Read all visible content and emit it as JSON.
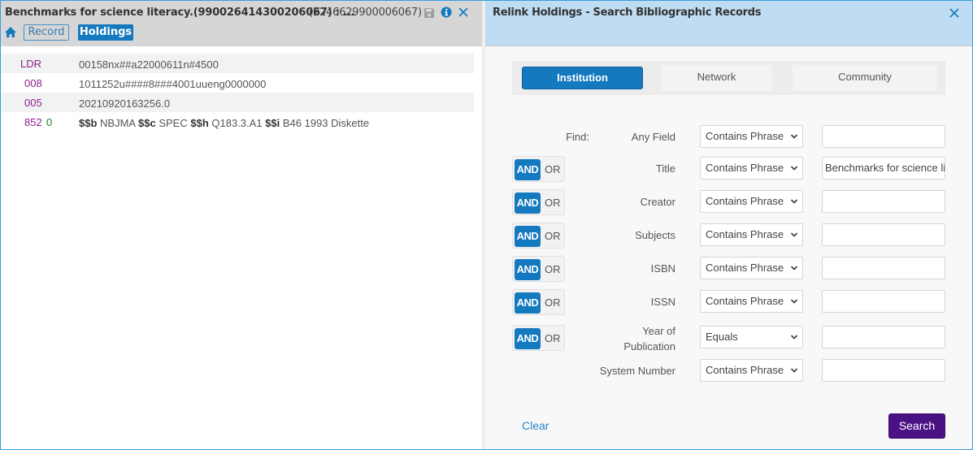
{
  "left_pane": {
    "title": "Benchmarks for science literacy.(990026414300206067) : ...",
    "record_id": "(2246629900006067)",
    "icons": {
      "save": "save-icon",
      "info": "info-icon",
      "close": "close-icon",
      "home": "home-icon"
    },
    "nav": {
      "record_label": "Record",
      "holdings_label": "Holdings"
    },
    "marc_fields": [
      {
        "tag": "LDR",
        "indicators": "",
        "value": "00158nx##a22000611n#4500"
      },
      {
        "tag": "008",
        "indicators": "",
        "value": "1011252u####8###4001uueng0000000"
      },
      {
        "tag": "005",
        "indicators": "",
        "value": "20210920163256.0"
      },
      {
        "tag": "852",
        "indicators": "0",
        "subfields": [
          {
            "code": "$$b",
            "value": "NBJMA"
          },
          {
            "code": "$$c",
            "value": "SPEC"
          },
          {
            "code": "$$h",
            "value": "Q183.3.A1"
          },
          {
            "code": "$$i",
            "value": "B46 1993 Diskette"
          }
        ]
      }
    ]
  },
  "right_pane": {
    "title": "Relink Holdings - Search Bibliographic Records",
    "close_icon": "close-icon",
    "tabs": [
      {
        "label": "Institution",
        "active": true
      },
      {
        "label": "Network",
        "active": false
      },
      {
        "label": "Community",
        "active": false
      }
    ],
    "find_label": "Find:",
    "rows": [
      {
        "field": "Any Field",
        "operator": "Contains Phrase",
        "value": "",
        "boolean": null
      },
      {
        "field": "Title",
        "operator": "Contains Phrase",
        "value": "Benchmarks for science literacy",
        "boolean": {
          "and": "AND",
          "or": "OR",
          "selected": "AND"
        }
      },
      {
        "field": "Creator",
        "operator": "Contains Phrase",
        "value": "",
        "boolean": {
          "and": "AND",
          "or": "OR",
          "selected": "AND"
        }
      },
      {
        "field": "Subjects",
        "operator": "Contains Phrase",
        "value": "",
        "boolean": {
          "and": "AND",
          "or": "OR",
          "selected": "AND"
        }
      },
      {
        "field": "ISBN",
        "operator": "Contains Phrase",
        "value": "",
        "boolean": {
          "and": "AND",
          "or": "OR",
          "selected": "AND"
        }
      },
      {
        "field": "ISSN",
        "operator": "Contains Phrase",
        "value": "",
        "boolean": {
          "and": "AND",
          "or": "OR",
          "selected": "AND"
        }
      },
      {
        "field": "Year of Publication",
        "operator": "Equals",
        "value": "",
        "boolean": {
          "and": "AND",
          "or": "OR",
          "selected": "AND"
        }
      },
      {
        "field": "System Number",
        "operator": "Contains Phrase",
        "value": "",
        "boolean": null
      }
    ],
    "clear_label": "Clear",
    "search_label": "Search"
  },
  "colors": {
    "primary": "#1479bf",
    "search_button": "#4b1284",
    "link": "#2b87c8",
    "marc_tag": "#8b1f8b",
    "marc_indicator": "#1c8a1c",
    "right_header": "#bfdcf2",
    "left_header": "#d6d6d6"
  }
}
